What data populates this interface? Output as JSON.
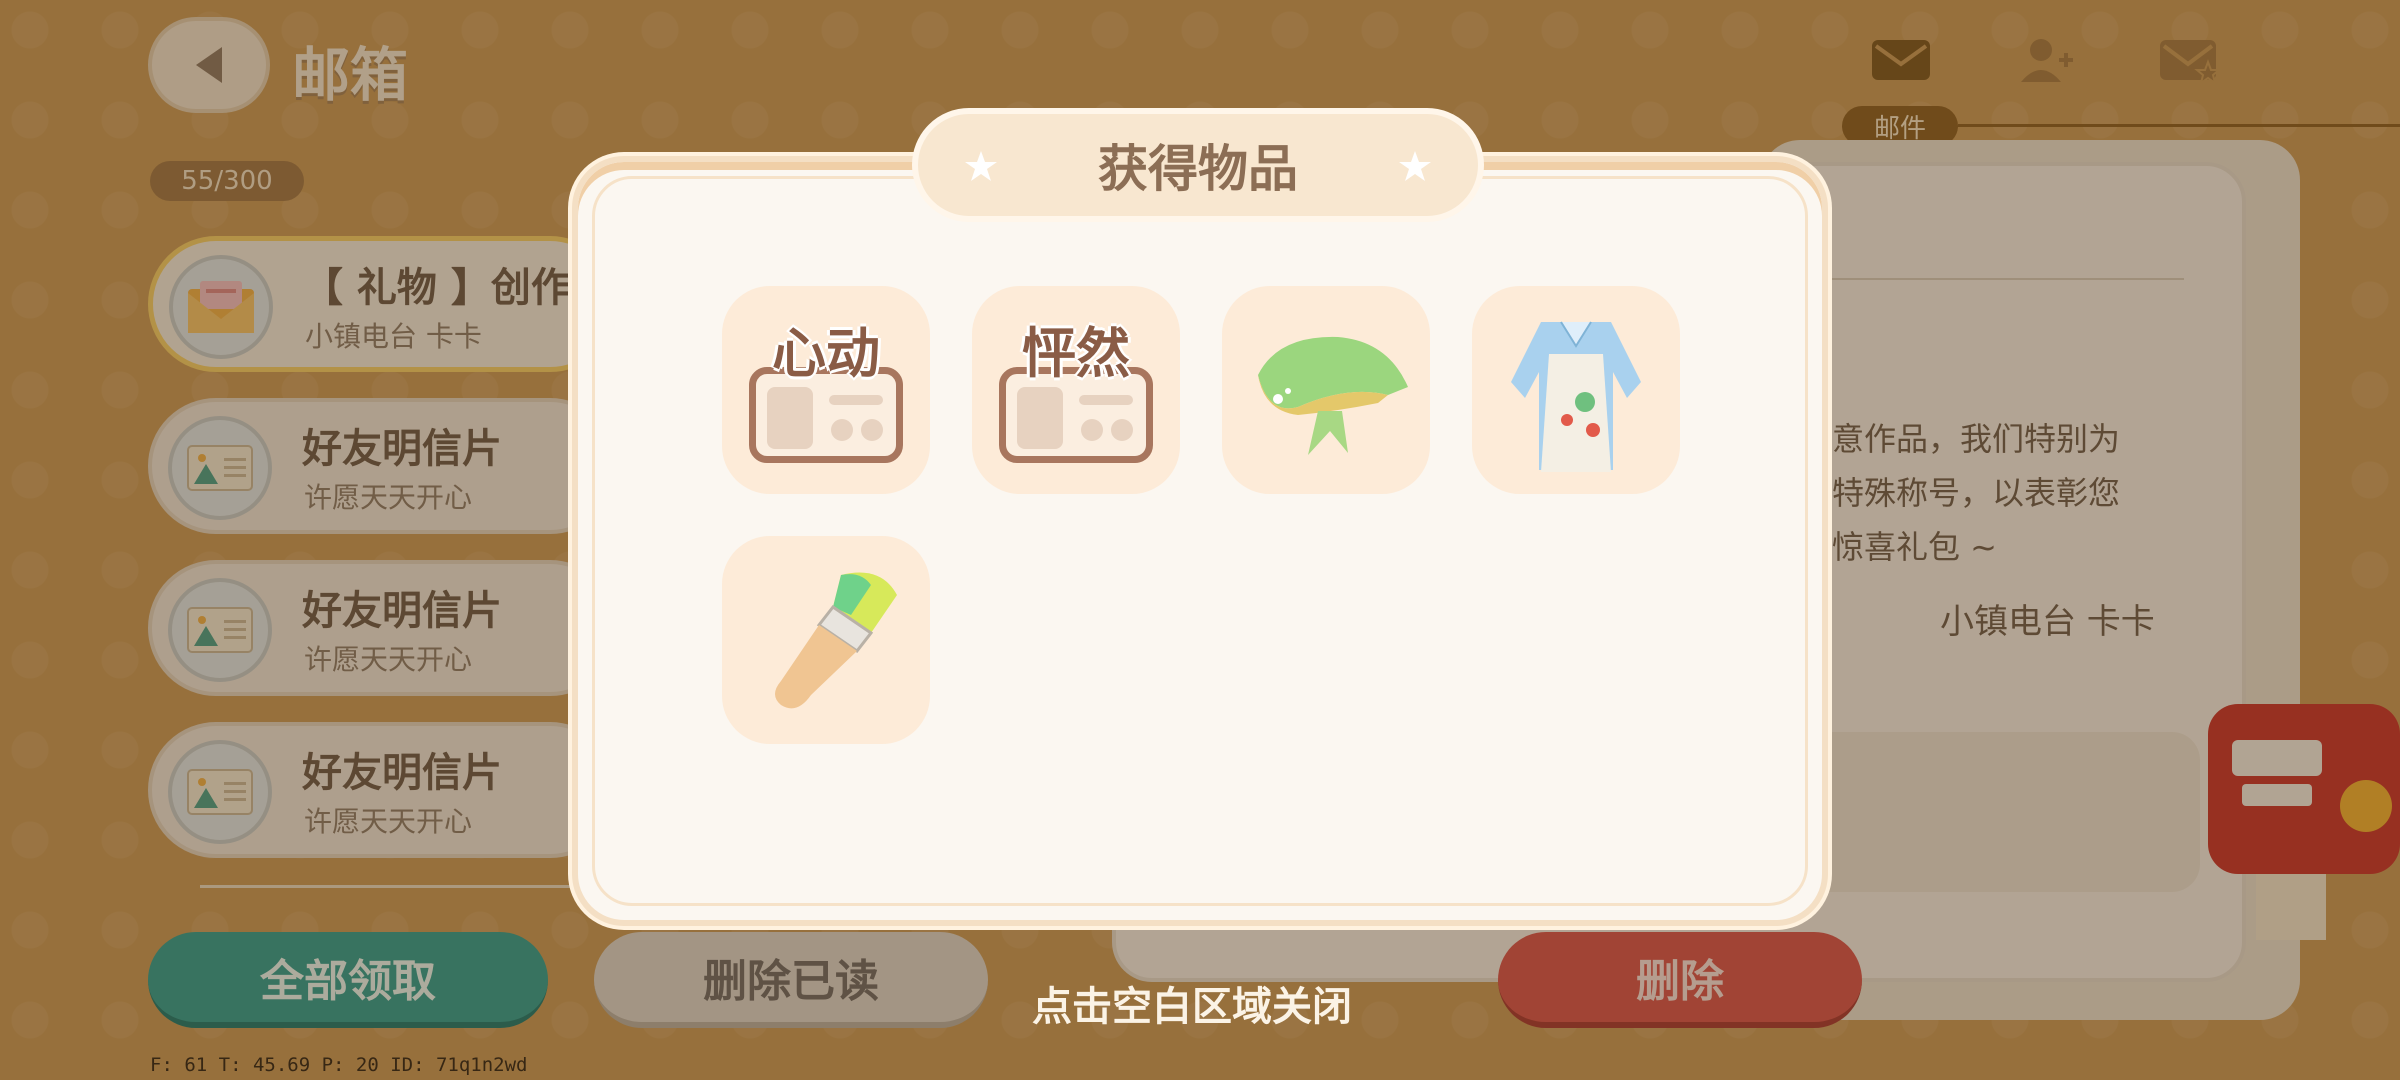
{
  "header": {
    "title": "邮箱",
    "mail_count": "55/300",
    "tabs": [
      {
        "label": "邮件",
        "icon": "mail-icon",
        "active": true
      },
      {
        "icon": "add-friend-icon"
      },
      {
        "icon": "starred-mail-icon"
      }
    ]
  },
  "mail_list": [
    {
      "title": "【 礼物 】创作者",
      "sender": "小镇电台 卡卡",
      "icon": "gift-envelope-icon",
      "selected": true
    },
    {
      "title": "好友明信片",
      "sender": "许愿天天开心",
      "icon": "postcard-icon"
    },
    {
      "title": "好友明信片",
      "sender": "许愿天天开心",
      "icon": "postcard-icon"
    },
    {
      "title": "好友明信片",
      "sender": "许愿天天开心",
      "icon": "postcard-icon"
    }
  ],
  "letter": {
    "line1": "意作品，我们特别为",
    "line2": "特殊称号，以表彰您",
    "line3": "惊喜礼包 ~",
    "signature": "小镇电台 卡卡"
  },
  "buttons": {
    "claim_all": "全部领取",
    "delete_read": "删除已读",
    "delete": "删除"
  },
  "popup": {
    "title": "获得物品",
    "items": [
      {
        "name": "心动",
        "type": "title-card"
      },
      {
        "name": "怦然",
        "type": "title-card"
      },
      {
        "name": "green-bandana-icon",
        "type": "hat"
      },
      {
        "name": "painter-apron-icon",
        "type": "outfit"
      },
      {
        "name": "paint-brush-icon",
        "type": "tool"
      }
    ],
    "close_hint": "点击空白区域关闭"
  },
  "debug": "F: 61    T: 45.69    P: 20    ID: 71q1n2wd",
  "colors": {
    "background": "#c99a57",
    "claim_button": "#2f9f92",
    "delete_button": "#d9534d",
    "popup_bg": "#fbf7f1"
  }
}
